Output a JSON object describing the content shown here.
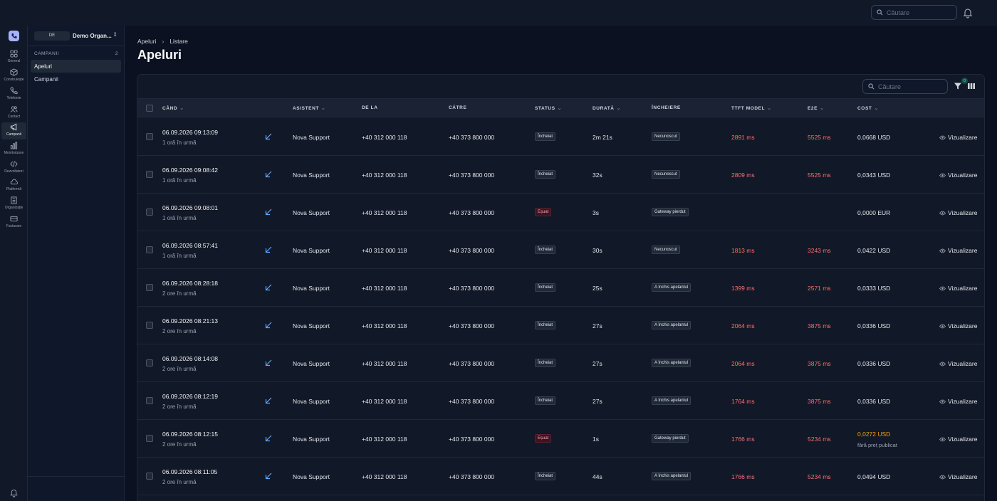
{
  "topbar": {
    "search_placeholder": "Căutare"
  },
  "rail": [
    {
      "label": "General",
      "icon": "grid-icon",
      "active": false
    },
    {
      "label": "Construiește",
      "icon": "cube-icon",
      "active": false
    },
    {
      "label": "Telefonie",
      "icon": "phone-icon",
      "active": false
    },
    {
      "label": "Contact",
      "icon": "users-icon",
      "active": false
    },
    {
      "label": "Campanii",
      "icon": "megaphone-icon",
      "active": true
    },
    {
      "label": "Monitorizare",
      "icon": "bar-chart-icon",
      "active": false
    },
    {
      "label": "Dezvoltatori",
      "icon": "code-icon",
      "active": false
    },
    {
      "label": "Platformă",
      "icon": "cloud-icon",
      "active": false
    },
    {
      "label": "Organizație",
      "icon": "building-icon",
      "active": false
    },
    {
      "label": "Facturare",
      "icon": "card-icon",
      "active": false
    }
  ],
  "sidebar": {
    "org_badge": "DE",
    "org_name": "Demo Organ...",
    "section_label": "CAMPANII",
    "section_count": "2",
    "items": [
      {
        "label": "Apeluri",
        "active": true
      },
      {
        "label": "Campanii",
        "active": false
      }
    ]
  },
  "breadcrumb": {
    "root": "Apeluri",
    "current": "Listare"
  },
  "page_title": "Apeluri",
  "table": {
    "search_placeholder": "Căutare",
    "filter_count": "0",
    "headers": {
      "when": "CÂND",
      "assistant": "ASISTENT",
      "from": "DE LA",
      "to": "CĂTRE",
      "status": "STATUS",
      "duration": "DURATĂ",
      "ending": "ÎNCHEIERE",
      "ttft": "TTFT MODEL",
      "e2e": "E2E",
      "cost": "COST"
    },
    "view_label": "Vizualizare",
    "rows": [
      {
        "date": "06.09.2026 09:13:09",
        "rel": "1 oră în urmă",
        "assistant": "Nova Support",
        "from": "+40 312 000 118",
        "to": "+40 373 800 000",
        "status": "Încheiat",
        "status_kind": "ok",
        "duration": "2m 21s",
        "ending": "Necunoscut",
        "ttft": "2891 ms",
        "e2e": "5525 ms",
        "cost": "0,0668 USD",
        "cost_sub": "",
        "cost_kind": "normal"
      },
      {
        "date": "06.09.2026 09:08:42",
        "rel": "1 oră în urmă",
        "assistant": "Nova Support",
        "from": "+40 312 000 118",
        "to": "+40 373 800 000",
        "status": "Încheiat",
        "status_kind": "ok",
        "duration": "32s",
        "ending": "Necunoscut",
        "ttft": "2809 ms",
        "e2e": "5525 ms",
        "cost": "0,0343 USD",
        "cost_sub": "",
        "cost_kind": "normal"
      },
      {
        "date": "06.09.2026 09:08:01",
        "rel": "1 oră în urmă",
        "assistant": "Nova Support",
        "from": "+40 312 000 118",
        "to": "+40 373 800 000",
        "status": "Eșuat",
        "status_kind": "fail",
        "duration": "3s",
        "ending": "Gateway pierdut",
        "ttft": "",
        "e2e": "",
        "cost": "0,0000 EUR",
        "cost_sub": "",
        "cost_kind": "normal"
      },
      {
        "date": "06.09.2026 08:57:41",
        "rel": "1 oră în urmă",
        "assistant": "Nova Support",
        "from": "+40 312 000 118",
        "to": "+40 373 800 000",
        "status": "Încheiat",
        "status_kind": "ok",
        "duration": "30s",
        "ending": "Necunoscut",
        "ttft": "1813 ms",
        "e2e": "3243 ms",
        "cost": "0,0422 USD",
        "cost_sub": "",
        "cost_kind": "normal"
      },
      {
        "date": "06.09.2026 08:28:18",
        "rel": "2 ore în urmă",
        "assistant": "Nova Support",
        "from": "+40 312 000 118",
        "to": "+40 373 800 000",
        "status": "Încheiat",
        "status_kind": "ok",
        "duration": "25s",
        "ending": "A închis apelantul",
        "ttft": "1399 ms",
        "e2e": "2571 ms",
        "cost": "0,0333 USD",
        "cost_sub": "",
        "cost_kind": "normal"
      },
      {
        "date": "06.09.2026 08:21:13",
        "rel": "2 ore în urmă",
        "assistant": "Nova Support",
        "from": "+40 312 000 118",
        "to": "+40 373 800 000",
        "status": "Încheiat",
        "status_kind": "ok",
        "duration": "27s",
        "ending": "A închis apelantul",
        "ttft": "2064 ms",
        "e2e": "3875 ms",
        "cost": "0,0336 USD",
        "cost_sub": "",
        "cost_kind": "normal"
      },
      {
        "date": "06.09.2026 08:14:08",
        "rel": "2 ore în urmă",
        "assistant": "Nova Support",
        "from": "+40 312 000 118",
        "to": "+40 373 800 000",
        "status": "Încheiat",
        "status_kind": "ok",
        "duration": "27s",
        "ending": "A închis apelantul",
        "ttft": "2064 ms",
        "e2e": "3875 ms",
        "cost": "0,0336 USD",
        "cost_sub": "",
        "cost_kind": "normal"
      },
      {
        "date": "06.09.2026 08:12:19",
        "rel": "2 ore în urmă",
        "assistant": "Nova Support",
        "from": "+40 312 000 118",
        "to": "+40 373 800 000",
        "status": "Încheiat",
        "status_kind": "ok",
        "duration": "27s",
        "ending": "A închis apelantul",
        "ttft": "1764 ms",
        "e2e": "3875 ms",
        "cost": "0,0336 USD",
        "cost_sub": "",
        "cost_kind": "normal"
      },
      {
        "date": "06.09.2026 08:12:15",
        "rel": "2 ore în urmă",
        "assistant": "Nova Support",
        "from": "+40 312 000 118",
        "to": "+40 373 800 000",
        "status": "Eșuat",
        "status_kind": "fail",
        "duration": "1s",
        "ending": "Gateway pierdut",
        "ttft": "1766 ms",
        "e2e": "5234 ms",
        "cost": "0,0272 USD",
        "cost_sub": "fără preț publicat",
        "cost_kind": "warn"
      },
      {
        "date": "06.09.2026 08:11:05",
        "rel": "2 ore în urmă",
        "assistant": "Nova Support",
        "from": "+40 312 000 118",
        "to": "+40 373 800 000",
        "status": "Încheiat",
        "status_kind": "ok",
        "duration": "44s",
        "ending": "A închis apelantul",
        "ttft": "1766 ms",
        "e2e": "5234 ms",
        "cost": "0,0494 USD",
        "cost_sub": "",
        "cost_kind": "normal"
      }
    ]
  }
}
